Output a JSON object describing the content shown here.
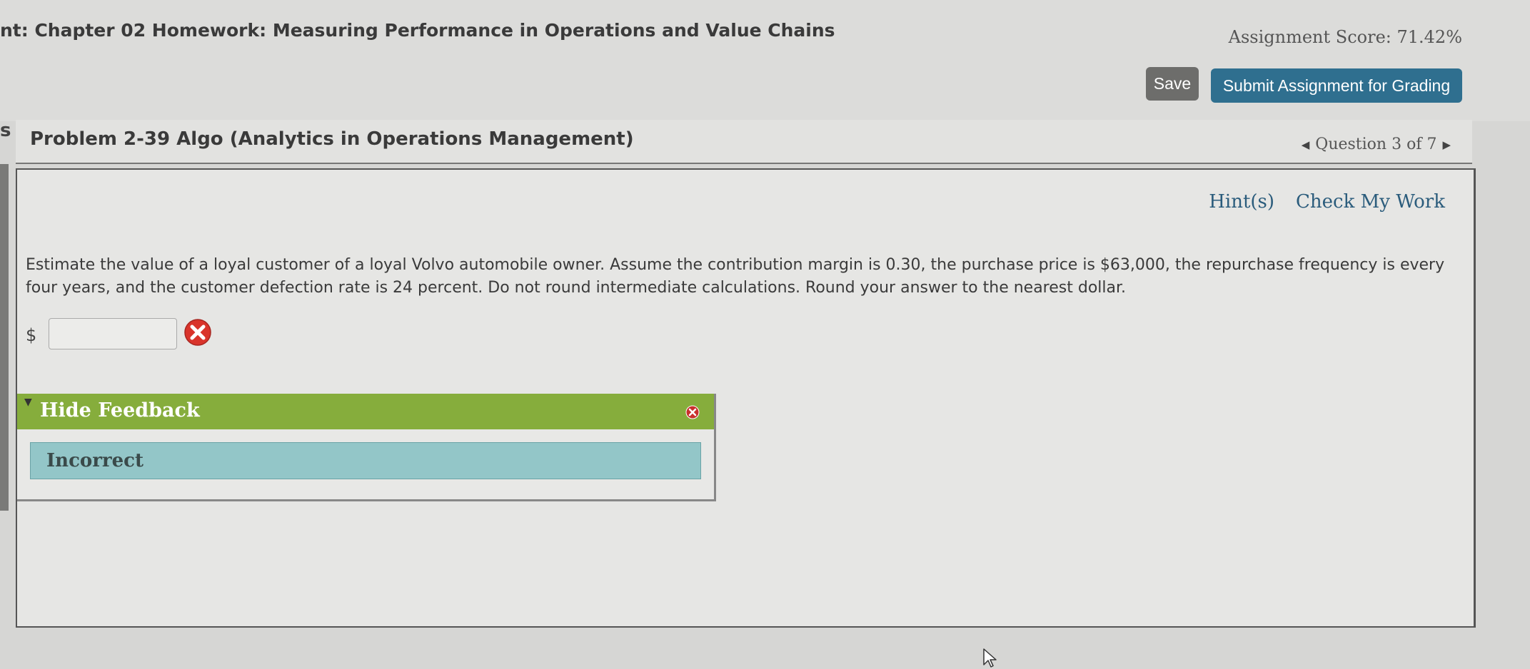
{
  "header": {
    "assignment_title": "nt: Chapter 02 Homework: Measuring Performance in Operations and Value Chains",
    "assignment_score": "Assignment Score: 71.42%",
    "save_label": "Save",
    "submit_label": "Submit Assignment for Grading"
  },
  "sidebar": {
    "edge_letter": "s"
  },
  "problem": {
    "title": "Problem 2-39 Algo (Analytics in Operations Management)",
    "question_nav": "Question 3 of 7",
    "hint_label": "Hint(s)",
    "check_label": "Check My Work",
    "question_text": "Estimate the value of a loyal customer of a loyal Volvo automobile owner. Assume the contribution margin is 0.30, the purchase price is $63,000, the repurchase frequency is every four years, and the customer defection rate is 24 percent. Do not round intermediate calculations. Round your answer to the nearest dollar.",
    "currency_symbol": "$",
    "answer_value": ""
  },
  "feedback": {
    "toggle_label": "Hide Feedback",
    "result": "Incorrect"
  },
  "colors": {
    "submit_bg": "#2f6f8f",
    "feedback_green": "#86ad3c",
    "incorrect_bg": "#93c6c8",
    "error_red": "#d9342b"
  },
  "icons": {
    "error": "error-x-icon",
    "close": "close-icon",
    "prev": "prev-triangle-icon",
    "next": "next-triangle-icon",
    "collapse": "collapse-triangle-icon",
    "pointer": "mouse-pointer-icon"
  }
}
